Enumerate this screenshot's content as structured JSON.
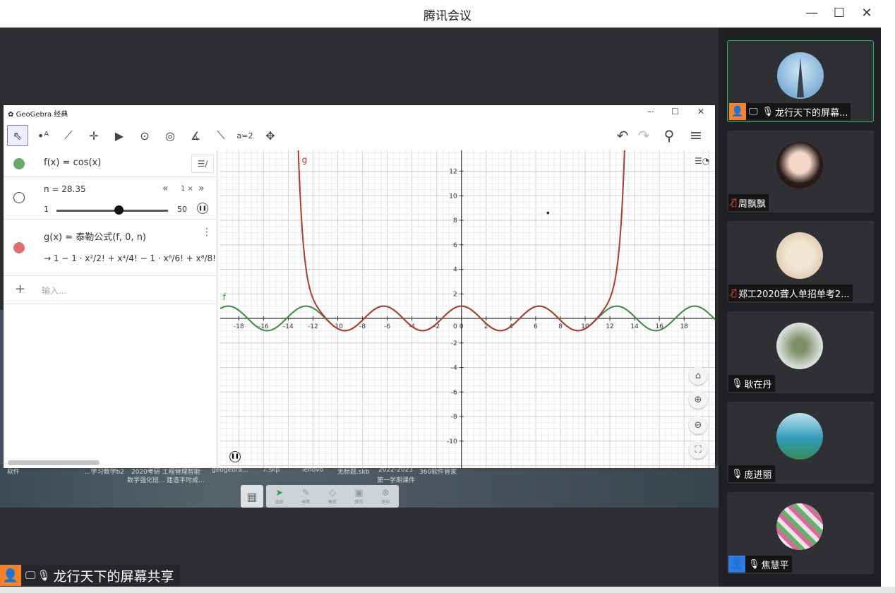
{
  "app": {
    "title": "腾讯会议"
  },
  "window_controls": {
    "minimize": "—",
    "maximize": "☐",
    "close": "✕"
  },
  "share": {
    "label": "龙行天下的屏幕共享",
    "avatar_color": "#f5822a"
  },
  "participants": [
    {
      "name": "龙行天下的屏幕...",
      "mic": "on",
      "sharing": true,
      "badge_color": "#f5822a",
      "active": true
    },
    {
      "name": "周飘飘",
      "mic": "muted"
    },
    {
      "name": "郑工2020聋人单招单考2...",
      "mic": "muted"
    },
    {
      "name": "耿在丹",
      "mic": "on"
    },
    {
      "name": "庞进丽",
      "mic": "on"
    },
    {
      "name": "焦慧平",
      "mic": "on",
      "badge_color": "#2f7ae5"
    }
  ],
  "desktop_icons": [
    "软件",
    "...学习数学b2",
    "2020考研 工程管理智能",
    "geogebra...",
    "7.skp",
    "lenovo",
    "无标题.skb",
    "2022-2023",
    "360软件管家"
  ],
  "desktop_icons_line2": [
    "数学强化班...",
    "建造平时成...",
    "第一学期课件"
  ],
  "annotation_tools": [
    {
      "icon": "pointer-icon",
      "glyph": "➤",
      "label": "选择",
      "active": true
    },
    {
      "icon": "pen-icon",
      "glyph": "✎",
      "label": "画笔"
    },
    {
      "icon": "eraser-icon",
      "glyph": "◇",
      "label": "橡皮"
    },
    {
      "icon": "save-icon",
      "glyph": "▣",
      "label": "保存"
    },
    {
      "icon": "exit-icon",
      "glyph": "⊗",
      "label": "退出"
    }
  ],
  "geogebra": {
    "title": "GeoGebra 经典",
    "algebra": {
      "f_expr": "f(x)  =  cos(x)",
      "n_label": "n  =  28.35",
      "n_value": 28.35,
      "n_min_label": "1",
      "n_max_label": "50",
      "n_min": 1,
      "n_max": 50,
      "speed": "1 ×",
      "speed_prev": "«",
      "speed_next": "»",
      "g_expr": "g(x)  =  泰勒公式(f, 0, n)",
      "g_result": "→  1 − 1 · x²/2! + x⁴/4! − 1 · x⁶/6! + x⁸/8! − 1 · x¹⁰/10! +",
      "input_placeholder": "输入...",
      "plus": "+",
      "f_color": "#6aa86a",
      "g_color": "#e07070"
    },
    "graph": {
      "f_label": "f",
      "g_label": "g",
      "f_color": "#3a8a3a",
      "g_color": "#b03a2e"
    }
  },
  "chart_data": {
    "type": "line",
    "xlim": [
      -19.5,
      20.5
    ],
    "ylim": [
      -12.2,
      13.7
    ],
    "x_ticks": [
      -18,
      -16,
      -14,
      -12,
      -10,
      -8,
      -6,
      -4,
      -2,
      0,
      2,
      4,
      6,
      8,
      10,
      12,
      14,
      16,
      18
    ],
    "y_ticks": [
      -10,
      -8,
      -6,
      -4,
      -2,
      2,
      4,
      6,
      8,
      10,
      12
    ],
    "grid": true,
    "series": [
      {
        "name": "f",
        "function": "cos(x)"
      },
      {
        "name": "g",
        "function": "Taylor(cos, 0, n)",
        "n": 28.35
      }
    ],
    "points": [
      {
        "x": 7.0,
        "y": 8.6
      }
    ]
  }
}
